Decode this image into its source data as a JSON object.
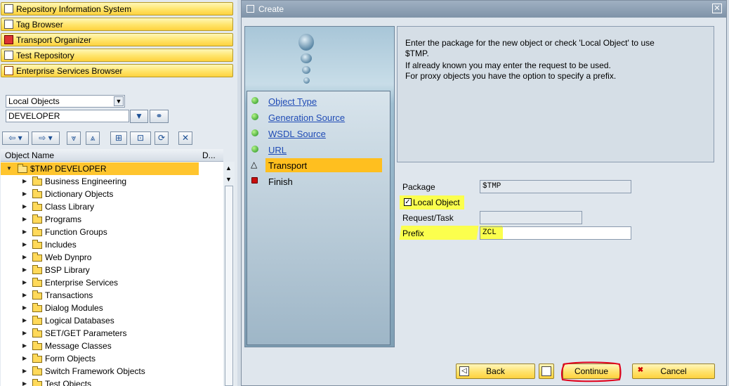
{
  "left": {
    "nav_buttons": [
      {
        "label": "Repository Information System",
        "icon": "hierarchy-icon"
      },
      {
        "label": "Tag Browser",
        "icon": "tag-icon"
      },
      {
        "label": "Transport Organizer",
        "icon": "truck-icon"
      },
      {
        "label": "Test Repository",
        "icon": "test-icon"
      },
      {
        "label": "Enterprise Services Browser",
        "icon": "services-icon"
      }
    ],
    "object_type_select": "Local Objects",
    "object_value_input": "DEVELOPER",
    "tree_header": {
      "col_name": "Object Name",
      "col_desc": "D..."
    },
    "tree_root": "$TMP DEVELOPER",
    "tree_items": [
      "Business Engineering",
      "Dictionary Objects",
      "Class Library",
      "Programs",
      "Function Groups",
      "Includes",
      "Web Dynpro",
      "BSP Library",
      "Enterprise Services",
      "Transactions",
      "Dialog Modules",
      "Logical Databases",
      "SET/GET Parameters",
      "Message Classes",
      "Form Objects",
      "Switch Framework Objects",
      "Test Objects"
    ]
  },
  "dialog": {
    "title": "Create",
    "close_glyph": "✕",
    "steps": [
      {
        "label": "Object Type",
        "status": "done"
      },
      {
        "label": "Generation Source",
        "status": "done"
      },
      {
        "label": "WSDL Source",
        "status": "done"
      },
      {
        "label": "URL",
        "status": "done"
      },
      {
        "label": "Transport",
        "status": "current"
      },
      {
        "label": "Finish",
        "status": "pending"
      }
    ],
    "info_lines": [
      "Enter the package for the new object or check 'Local Object' to use",
      "$TMP.",
      "If already known you may enter the request to be used.",
      "For proxy objects you have the option to specify a prefix."
    ],
    "package_label": "Package",
    "package_value": "$TMP",
    "local_object_label": "Local Object",
    "local_object_checked": true,
    "request_label": "Request/Task",
    "request_value": "",
    "prefix_label": "Prefix",
    "prefix_value": "ZCL",
    "back_label": "Back",
    "continue_label": "Continue",
    "cancel_label": "Cancel"
  },
  "colors": {
    "yellow_button": "#ffe26b",
    "highlight": "#fbff4d",
    "current_step": "#ffbf1f",
    "link": "#1f4bb5",
    "annotation_red": "#e0001b"
  }
}
